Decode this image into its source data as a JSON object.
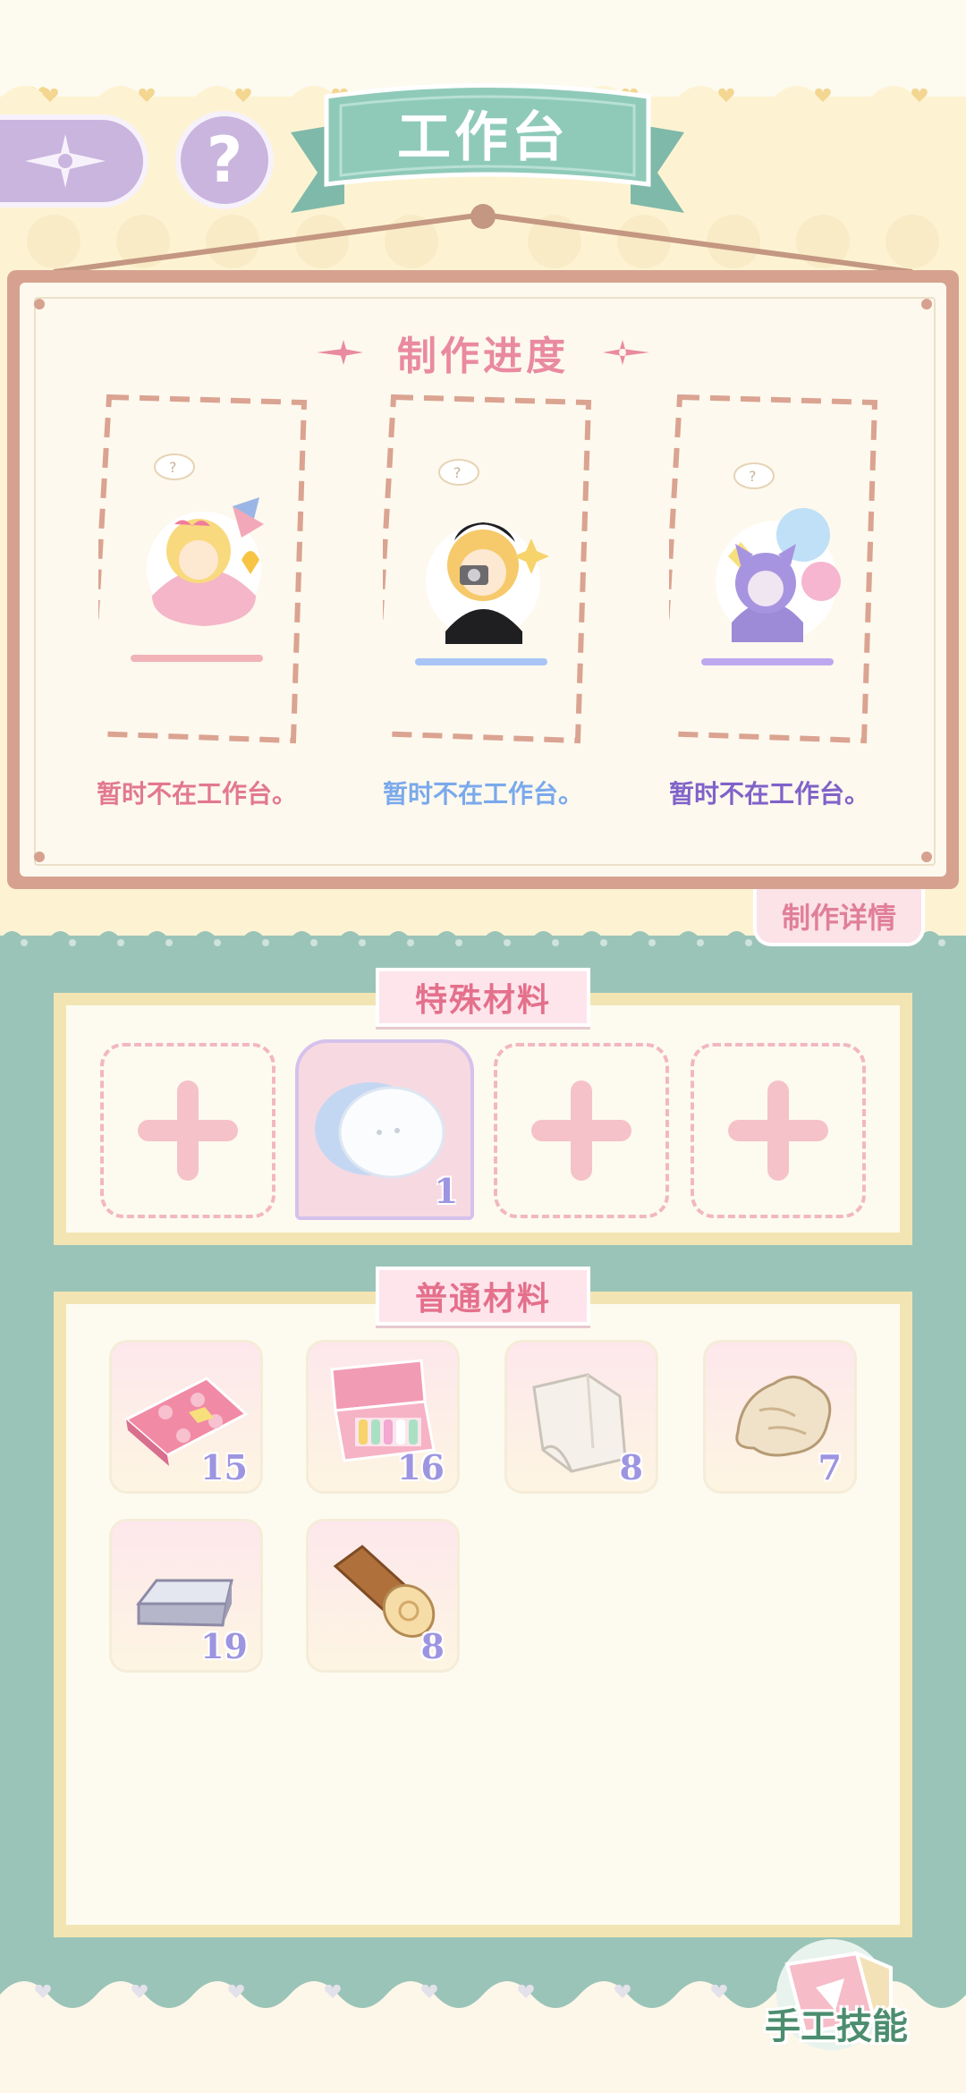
{
  "header": {
    "title": "工作台",
    "back_icon": "compass-star-icon",
    "help_label": "?"
  },
  "progress": {
    "title": "制作进度",
    "slots": [
      {
        "status": "暂时不在工作台。",
        "color": "#e2788f",
        "bar_color": "#f2b3b8"
      },
      {
        "status": "暂时不在工作台。",
        "color": "#7aa9ec",
        "bar_color": "#a9c4f6"
      },
      {
        "status": "暂时不在工作台。",
        "color": "#8062c9",
        "bar_color": "#bda8ef"
      }
    ],
    "details_label": "制作详情"
  },
  "special_materials": {
    "title": "特殊材料",
    "slots": [
      {
        "type": "empty",
        "icon": "plus-icon"
      },
      {
        "type": "item",
        "icon": "cotton-ball-icon",
        "count": "1"
      },
      {
        "type": "empty",
        "icon": "plus-icon"
      },
      {
        "type": "empty",
        "icon": "plus-icon"
      }
    ]
  },
  "normal_materials": {
    "title": "普通材料",
    "items": [
      {
        "icon": "polka-dot-fabric-icon",
        "count": "15"
      },
      {
        "icon": "paint-box-icon",
        "count": "16"
      },
      {
        "icon": "white-cloth-icon",
        "count": "8"
      },
      {
        "icon": "fur-pelt-icon",
        "count": "7"
      },
      {
        "icon": "silver-ingot-icon",
        "count": "19"
      },
      {
        "icon": "wood-log-icon",
        "count": "8"
      }
    ]
  },
  "footer": {
    "craft_skill_label": "手工技能"
  },
  "colors": {
    "teal": "#9bc4b8",
    "banner": "#8cc7b7",
    "pink": "#e4708c",
    "count_purple": "#9d95e0"
  }
}
